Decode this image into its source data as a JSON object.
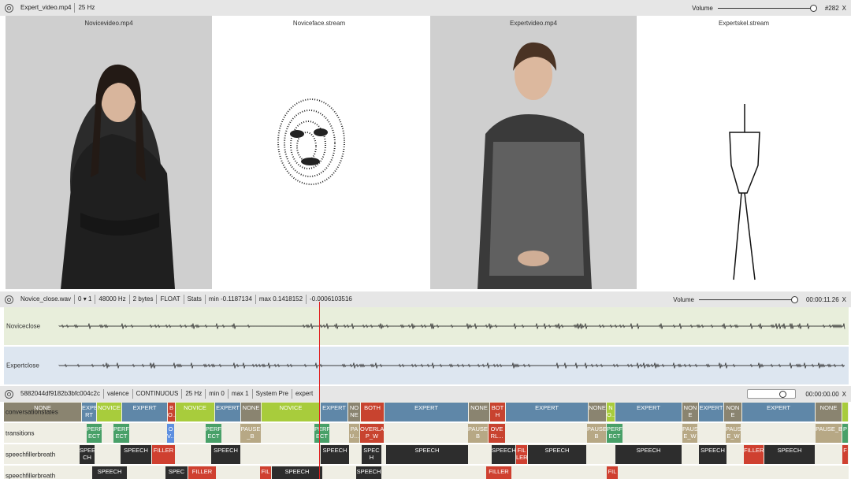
{
  "video_bar": {
    "file": "Expert_video.mp4",
    "rate": "25 Hz",
    "volume_label": "Volume",
    "frame": "#282",
    "close": "X",
    "volume_level": 1.0
  },
  "panels": [
    {
      "label": "Novicevideo.mp4"
    },
    {
      "label": "Noviceface.stream"
    },
    {
      "label": "Expertvideo.mp4"
    },
    {
      "label": "Expertskel.stream"
    }
  ],
  "audio_bar": {
    "file": "Novice_close.wav",
    "channel": "0",
    "channels": "1",
    "rate": "48000 Hz",
    "bytes": "2 bytes",
    "type": "FLOAT",
    "stats": "Stats",
    "min": "min -0.1187134",
    "max": "max 0.1418152",
    "value": "-0.0006103516",
    "volume_label": "Volume",
    "time": "00:00:11.26",
    "close": "X",
    "volume_level": 1.0
  },
  "audio_tracks": [
    {
      "name": "Noviceclose",
      "color": "#e8eedb"
    },
    {
      "name": "Expertclose",
      "color": "#dde6f0"
    }
  ],
  "anno_bar": {
    "id": "5882044df9182b3bfc004c2c",
    "scheme": "valence",
    "type": "CONTINUOUS",
    "rate": "25 Hz",
    "min": "min 0",
    "max": "max 1",
    "system": "System Pre",
    "annotator": "expert",
    "time": "00:00:00.00",
    "close": "X",
    "slider_level": 0.7
  },
  "colors": {
    "expert": "#5f87a8",
    "novice": "#a8cc3c",
    "both": "#c8432f",
    "none": "#8a8470",
    "perfect": "#48a068",
    "overlap": "#5d8fe0",
    "pause": "#b7a885",
    "speech": "#2d2d2d",
    "filler": "#cf4030"
  },
  "rows": [
    {
      "name": "conversationstates",
      "segments": [
        {
          "s": 0,
          "e": 99,
          "label": "NONE",
          "c": "none"
        },
        {
          "s": 99,
          "e": 118,
          "label": "EXPE RT",
          "c": "expert"
        },
        {
          "s": 118,
          "e": 150,
          "label": "NOVICE",
          "c": "novice"
        },
        {
          "s": 150,
          "e": 208,
          "label": "EXPERT",
          "c": "expert"
        },
        {
          "s": 208,
          "e": 218,
          "label": "B O...",
          "c": "both"
        },
        {
          "s": 218,
          "e": 268,
          "label": "NOVICE",
          "c": "novice"
        },
        {
          "s": 268,
          "e": 301,
          "label": "EXPERT",
          "c": "expert"
        },
        {
          "s": 301,
          "e": 327,
          "label": "NONE",
          "c": "none"
        },
        {
          "s": 327,
          "e": 402,
          "label": "NOVICE",
          "c": "novice"
        },
        {
          "s": 402,
          "e": 437,
          "label": "EXPERT",
          "c": "expert"
        },
        {
          "s": 437,
          "e": 453,
          "label": "NO NE",
          "c": "none"
        },
        {
          "s": 453,
          "e": 483,
          "label": "BOTH",
          "c": "both"
        },
        {
          "s": 483,
          "e": 590,
          "label": "EXPERT",
          "c": "expert"
        },
        {
          "s": 590,
          "e": 617,
          "label": "NONE",
          "c": "none"
        },
        {
          "s": 617,
          "e": 637,
          "label": "BOT H",
          "c": "both"
        },
        {
          "s": 637,
          "e": 742,
          "label": "EXPERT",
          "c": "expert"
        },
        {
          "s": 742,
          "e": 765,
          "label": "NONE",
          "c": "none"
        },
        {
          "s": 765,
          "e": 776,
          "label": "N O...",
          "c": "novice"
        },
        {
          "s": 776,
          "e": 861,
          "label": "EXPERT",
          "c": "expert"
        },
        {
          "s": 861,
          "e": 882,
          "label": "NON E",
          "c": "none"
        },
        {
          "s": 882,
          "e": 914,
          "label": "EXPERT",
          "c": "expert"
        },
        {
          "s": 914,
          "e": 937,
          "label": "NON E",
          "c": "none"
        },
        {
          "s": 937,
          "e": 1030,
          "label": "EXPERT",
          "c": "expert"
        },
        {
          "s": 1030,
          "e": 1064,
          "label": "NONE",
          "c": "none"
        },
        {
          "s": 1064,
          "e": 1072,
          "label": "",
          "c": "novice"
        }
      ]
    },
    {
      "name": "transitions",
      "segments": [
        {
          "s": 105,
          "e": 125,
          "label": "PERF ECT",
          "c": "perfect"
        },
        {
          "s": 139,
          "e": 160,
          "label": "PERF ECT",
          "c": "perfect"
        },
        {
          "s": 207,
          "e": 217,
          "label": "O V...",
          "c": "overlap"
        },
        {
          "s": 256,
          "e": 277,
          "label": "PERF ECT",
          "c": "perfect"
        },
        {
          "s": 300,
          "e": 327,
          "label": "PAUSE _B",
          "c": "pause"
        },
        {
          "s": 394,
          "e": 414,
          "label": "PERF ECT",
          "c": "perfect"
        },
        {
          "s": 438,
          "e": 452,
          "label": "PA U...",
          "c": "pause"
        },
        {
          "s": 452,
          "e": 483,
          "label": "OVERLA P_W",
          "c": "both"
        },
        {
          "s": 589,
          "e": 615,
          "label": "PAUSE_ B",
          "c": "pause"
        },
        {
          "s": 615,
          "e": 637,
          "label": "OVE RL...",
          "c": "both"
        },
        {
          "s": 740,
          "e": 765,
          "label": "PAUSE_ B",
          "c": "pause"
        },
        {
          "s": 765,
          "e": 786,
          "label": "PERF ECT",
          "c": "perfect"
        },
        {
          "s": 861,
          "e": 881,
          "label": "PAUS E_W",
          "c": "pause"
        },
        {
          "s": 916,
          "e": 936,
          "label": "PAUS E_W",
          "c": "pause"
        },
        {
          "s": 1030,
          "e": 1064,
          "label": "PAUSE_B",
          "c": "pause"
        },
        {
          "s": 1064,
          "e": 1072,
          "label": "P",
          "c": "perfect"
        }
      ]
    },
    {
      "name": "speechfillerbreath",
      "segments": [
        {
          "s": 96,
          "e": 116,
          "label": "SPEE CH",
          "c": "speech"
        },
        {
          "s": 148,
          "e": 188,
          "label": "SPEECH",
          "c": "speech"
        },
        {
          "s": 188,
          "e": 218,
          "label": "FILLER",
          "c": "filler"
        },
        {
          "s": 263,
          "e": 301,
          "label": "SPEECH",
          "c": "speech"
        },
        {
          "s": 402,
          "e": 439,
          "label": "SPEECH",
          "c": "speech"
        },
        {
          "s": 454,
          "e": 480,
          "label": "SPEC H",
          "c": "speech"
        },
        {
          "s": 485,
          "e": 590,
          "label": "SPEECH",
          "c": "speech"
        },
        {
          "s": 619,
          "e": 650,
          "label": "SPEECH",
          "c": "speech"
        },
        {
          "s": 650,
          "e": 665,
          "label": "FIL LER",
          "c": "filler"
        },
        {
          "s": 665,
          "e": 740,
          "label": "SPEECH",
          "c": "speech"
        },
        {
          "s": 776,
          "e": 861,
          "label": "SPEECH",
          "c": "speech"
        },
        {
          "s": 882,
          "e": 918,
          "label": "SPEECH",
          "c": "speech"
        },
        {
          "s": 939,
          "e": 965,
          "label": "FILLER",
          "c": "filler"
        },
        {
          "s": 965,
          "e": 1030,
          "label": "SPEECH",
          "c": "speech"
        },
        {
          "s": 1064,
          "e": 1072,
          "label": "F",
          "c": "filler"
        }
      ]
    },
    {
      "name": "speechfillerbreath",
      "segments": [
        {
          "s": 112,
          "e": 157,
          "label": "SPEECH",
          "c": "speech"
        },
        {
          "s": 205,
          "e": 234,
          "label": "SPEC",
          "c": "speech"
        },
        {
          "s": 234,
          "e": 270,
          "label": "FILLER",
          "c": "filler"
        },
        {
          "s": 325,
          "e": 340,
          "label": "FIL",
          "c": "filler"
        },
        {
          "s": 340,
          "e": 405,
          "label": "SPEECH",
          "c": "speech"
        },
        {
          "s": 447,
          "e": 480,
          "label": "SPEECH",
          "c": "speech"
        },
        {
          "s": 612,
          "e": 645,
          "label": "FILLER",
          "c": "filler"
        },
        {
          "s": 765,
          "e": 780,
          "label": "FIL",
          "c": "filler"
        }
      ]
    }
  ]
}
